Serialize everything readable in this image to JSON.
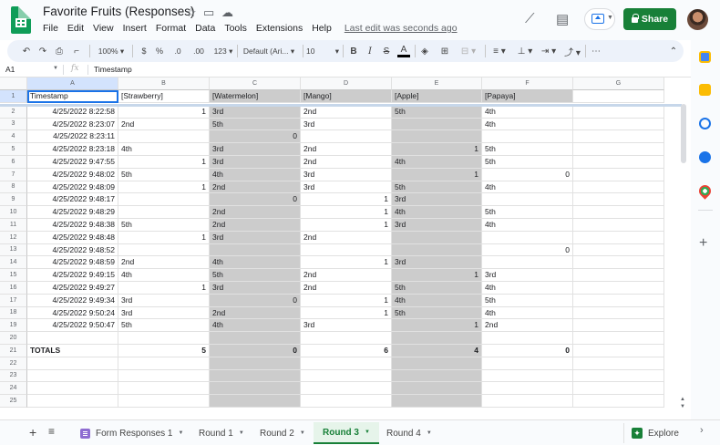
{
  "doc": {
    "title": "Favorite Fruits (Responses)",
    "menu": [
      "File",
      "Edit",
      "View",
      "Insert",
      "Format",
      "Data",
      "Tools",
      "Extensions",
      "Help"
    ],
    "last_edit": "Last edit was seconds ago",
    "share_label": "Share"
  },
  "toolbar": {
    "zoom": "100%",
    "currency": "$",
    "percent": "%",
    "dec_decrease": ".0",
    "dec_increase": ".00",
    "more_formats": "123",
    "font": "Default (Ari...",
    "font_size": "10",
    "bold": "B",
    "italic": "I",
    "strike": "S",
    "text_color": "A"
  },
  "formula_bar": {
    "cell_ref": "A1",
    "fx": "fx",
    "value": "Timestamp"
  },
  "columns": [
    "A",
    "B",
    "C",
    "D",
    "E",
    "F",
    "G"
  ],
  "rows": [
    {
      "n": "1",
      "c": [
        "Timestamp",
        "[Strawberry]",
        "[Watermelon]",
        "[Mango]",
        "[Apple]",
        "[Papaya]",
        ""
      ]
    },
    {
      "n": "2",
      "c": [
        "4/25/2022 8:22:58",
        "1",
        "3rd",
        "2nd",
        "5th",
        "4th",
        ""
      ]
    },
    {
      "n": "3",
      "c": [
        "4/25/2022 8:23:07",
        "2nd",
        "5th",
        "3rd",
        "",
        "4th",
        ""
      ]
    },
    {
      "n": "4",
      "c": [
        "4/25/2022 8:23:11",
        "",
        "0",
        "",
        "",
        "",
        ""
      ]
    },
    {
      "n": "5",
      "c": [
        "4/25/2022 8:23:18",
        "4th",
        "3rd",
        "2nd",
        "1",
        "5th",
        ""
      ]
    },
    {
      "n": "6",
      "c": [
        "4/25/2022 9:47:55",
        "1",
        "3rd",
        "2nd",
        "4th",
        "5th",
        ""
      ]
    },
    {
      "n": "7",
      "c": [
        "4/25/2022 9:48:02",
        "5th",
        "4th",
        "3rd",
        "1",
        "0",
        ""
      ]
    },
    {
      "n": "8",
      "c": [
        "4/25/2022 9:48:09",
        "1",
        "2nd",
        "3rd",
        "5th",
        "4th",
        ""
      ]
    },
    {
      "n": "9",
      "c": [
        "4/25/2022 9:48:17",
        "",
        "0",
        "1",
        "3rd",
        "",
        ""
      ]
    },
    {
      "n": "10",
      "c": [
        "4/25/2022 9:48:29",
        "",
        "2nd",
        "1",
        "4th",
        "5th",
        ""
      ]
    },
    {
      "n": "11",
      "c": [
        "4/25/2022 9:48:38",
        "5th",
        "2nd",
        "1",
        "3rd",
        "4th",
        ""
      ]
    },
    {
      "n": "12",
      "c": [
        "4/25/2022 9:48:48",
        "1",
        "3rd",
        "2nd",
        "",
        "",
        ""
      ]
    },
    {
      "n": "13",
      "c": [
        "4/25/2022 9:48:52",
        "",
        "",
        "",
        "",
        "0",
        ""
      ]
    },
    {
      "n": "14",
      "c": [
        "4/25/2022 9:48:59",
        "2nd",
        "4th",
        "1",
        "3rd",
        "",
        ""
      ]
    },
    {
      "n": "15",
      "c": [
        "4/25/2022 9:49:15",
        "4th",
        "5th",
        "2nd",
        "1",
        "3rd",
        ""
      ]
    },
    {
      "n": "16",
      "c": [
        "4/25/2022 9:49:27",
        "1",
        "3rd",
        "2nd",
        "5th",
        "4th",
        ""
      ]
    },
    {
      "n": "17",
      "c": [
        "4/25/2022 9:49:34",
        "3rd",
        "0",
        "1",
        "4th",
        "5th",
        ""
      ]
    },
    {
      "n": "18",
      "c": [
        "4/25/2022 9:50:24",
        "3rd",
        "2nd",
        "1",
        "5th",
        "4th",
        ""
      ]
    },
    {
      "n": "19",
      "c": [
        "4/25/2022 9:50:47",
        "5th",
        "4th",
        "3rd",
        "1",
        "2nd",
        ""
      ]
    },
    {
      "n": "20",
      "c": [
        "",
        "",
        "",
        "",
        "",
        "",
        ""
      ]
    },
    {
      "n": "21",
      "c": [
        "TOTALS",
        "5",
        "0",
        "6",
        "4",
        "0",
        ""
      ]
    },
    {
      "n": "22",
      "c": [
        "",
        "",
        "",
        "",
        "",
        "",
        ""
      ]
    },
    {
      "n": "23",
      "c": [
        "",
        "",
        "",
        "",
        "",
        "",
        ""
      ]
    },
    {
      "n": "24",
      "c": [
        "",
        "",
        "",
        "",
        "",
        "",
        ""
      ]
    },
    {
      "n": "25",
      "c": [
        "",
        "",
        "",
        "",
        "",
        "",
        ""
      ]
    }
  ],
  "tabs": [
    {
      "label": "Form Responses 1",
      "active": false
    },
    {
      "label": "Round 1",
      "active": false
    },
    {
      "label": "Round 2",
      "active": false
    },
    {
      "label": "Round 3",
      "active": true
    },
    {
      "label": "Round 4",
      "active": false
    }
  ],
  "explore_label": "Explore",
  "colors": {
    "accent": "#188038",
    "selection": "#1a73e8",
    "gray_fill": "#cccccc"
  }
}
